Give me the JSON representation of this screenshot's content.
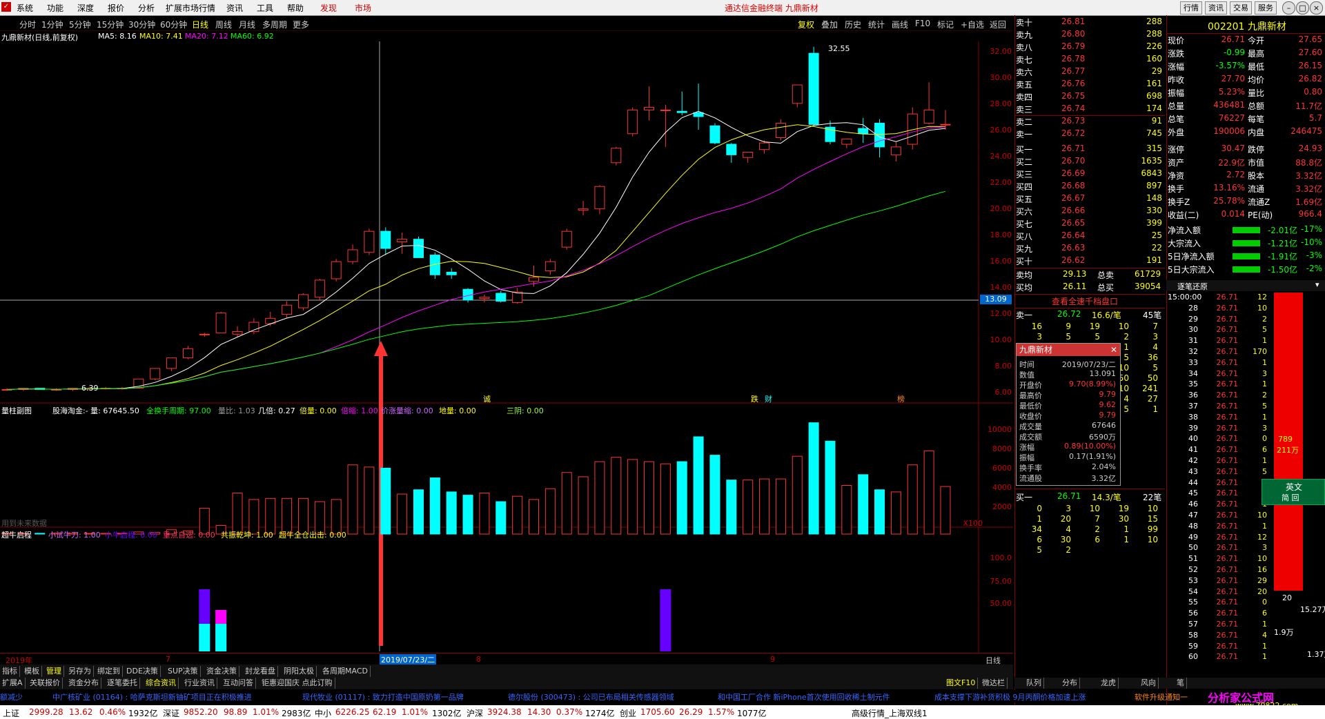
{
  "menu": {
    "items": [
      "系统",
      "功能",
      "深度",
      "报价",
      "分析",
      "扩展市场行情",
      "资讯",
      "工具",
      "帮助"
    ],
    "discover": "发现",
    "market": "市场",
    "title": "通达信金融终端  九鼎新材",
    "right_buttons": [
      "行情",
      "资讯",
      "交易",
      "服务"
    ]
  },
  "period_tabs": [
    "分时",
    "1分钟",
    "5分钟",
    "15分钟",
    "30分钟",
    "60分钟",
    "日线",
    "周线",
    "月线",
    "多周期",
    "更多"
  ],
  "period_active": "日线",
  "right_tools": [
    "复权",
    "叠加",
    "历史",
    "统计",
    "画线",
    "F10",
    "标记",
    "+自选",
    "返回"
  ],
  "main_info": {
    "name": "九鼎新材(日线,前复权)",
    "ma5": "MA5: 8.16",
    "ma10": "MA10: 7.41",
    "ma20": "MA20: 7.12",
    "ma60": "MA60: 6.92"
  },
  "price_axis": [
    "32.00",
    "30.00",
    "28.00",
    "26.00",
    "24.00",
    "22.00",
    "20.00",
    "18.00",
    "16.00",
    "14.00",
    "12.00",
    "10.00",
    "8.00",
    "6.00"
  ],
  "crosshair_price": "13.09",
  "high_label": "32.55",
  "low_label": "6.39",
  "markers": [
    "诚",
    "跌",
    "财",
    "榜"
  ],
  "volume_info": {
    "title": "量柱副图",
    "text1": "股海淘金:- 量: 67645.50",
    "text2": "全换手周期: 97.00",
    "text3": "量比: 1.03",
    "text4": "几倍: 0.27",
    "text5": "倍量: 0.00",
    "text6": "倍缩: 1.00",
    "text7": "价涨量缩: 0.00",
    "text8": "地量: 0.00",
    "text9": "三阴: 0.00",
    "watermark": "用到未来数据"
  },
  "volume_axis": [
    "10000",
    "8000",
    "6000",
    "4000",
    "2000"
  ],
  "volume_unit": "X100",
  "ind_info": {
    "title": "超牛启程",
    "t1": "小试牛刀: 1.00",
    "t2": "小牛启程: 0.00",
    "t3": "重点自选: 0.00",
    "t4": "共振乾坤: 1.00",
    "t5": "超牛全仓出击: 0.00"
  },
  "ind_axis": [
    "100.0",
    "75.00",
    "50.00"
  ],
  "time_axis": {
    "year": "2019年",
    "m7": "7",
    "date": "2019/07/23/二",
    "m8": "8",
    "m9": "9",
    "period": "日线"
  },
  "chart_data": {
    "type": "candlestick",
    "ylim": [
      6,
      33
    ],
    "candles": [
      [
        6.6,
        6.7,
        6.5,
        6.6
      ],
      [
        6.6,
        6.7,
        6.5,
        6.7
      ],
      [
        6.7,
        6.7,
        6.6,
        6.6
      ],
      [
        6.6,
        6.7,
        6.5,
        6.6
      ],
      [
        6.6,
        6.7,
        6.5,
        6.7
      ],
      [
        6.7,
        6.8,
        6.6,
        6.7
      ],
      [
        6.7,
        6.8,
        6.6,
        6.7
      ],
      [
        6.7,
        6.8,
        6.6,
        6.7
      ],
      [
        6.7,
        7.4,
        6.7,
        7.4
      ],
      [
        7.4,
        8.2,
        7.3,
        8.2
      ],
      [
        8.2,
        9.0,
        8.0,
        9.0
      ],
      [
        9.0,
        9.9,
        8.9,
        9.7
      ],
      [
        10.8,
        10.9,
        10.6,
        10.8
      ],
      [
        10.9,
        12.5,
        10.9,
        12.4
      ],
      [
        10.8,
        11.4,
        10.6,
        11.0
      ],
      [
        11.0,
        12.0,
        10.8,
        11.7
      ],
      [
        11.6,
        12.5,
        11.4,
        12.0
      ],
      [
        12.3,
        13.3,
        12.0,
        13.0
      ],
      [
        12.8,
        13.9,
        12.6,
        13.8
      ],
      [
        13.6,
        15.0,
        13.4,
        14.9
      ],
      [
        15.0,
        16.5,
        14.8,
        16.3
      ],
      [
        16.3,
        17.6,
        16.1,
        17.2
      ],
      [
        17.0,
        18.8,
        16.8,
        18.6
      ],
      [
        18.6,
        18.9,
        16.8,
        17.3
      ],
      [
        17.8,
        18.5,
        16.9,
        18.0
      ],
      [
        18.0,
        18.2,
        16.6,
        16.6
      ],
      [
        16.8,
        17.0,
        15.0,
        15.3
      ],
      [
        15.5,
        15.8,
        15.0,
        15.3
      ],
      [
        14.2,
        14.3,
        13.2,
        13.4
      ],
      [
        13.5,
        13.8,
        13.2,
        13.6
      ],
      [
        13.9,
        14.1,
        13.2,
        13.3
      ],
      [
        13.2,
        14.3,
        13.1,
        14.0
      ],
      [
        14.8,
        16.0,
        14.4,
        15.1
      ],
      [
        15.6,
        16.5,
        15.3,
        16.3
      ],
      [
        17.4,
        18.8,
        17.2,
        18.6
      ],
      [
        20.2,
        20.9,
        19.8,
        20.3
      ],
      [
        20.3,
        22.1,
        19.9,
        22.0
      ],
      [
        23.8,
        25.0,
        23.6,
        24.9
      ],
      [
        26.0,
        28.0,
        25.8,
        27.8
      ],
      [
        27.8,
        29.6,
        27.0,
        28.0
      ],
      [
        27.8,
        28.2,
        25.0,
        27.8
      ],
      [
        27.7,
        29.2,
        27.4,
        27.6
      ],
      [
        27.6,
        29.8,
        26.3,
        27.3
      ],
      [
        26.6,
        26.8,
        25.2,
        25.3
      ],
      [
        25.2,
        25.3,
        23.8,
        24.4
      ],
      [
        24.2,
        24.5,
        23.8,
        24.6
      ],
      [
        24.8,
        25.5,
        24.5,
        25.3
      ],
      [
        25.7,
        27.1,
        25.5,
        26.8
      ],
      [
        28.3,
        29.7,
        28.0,
        29.7
      ],
      [
        32.1,
        32.6,
        26.6,
        26.7
      ],
      [
        26.5,
        27.0,
        25.2,
        25.4
      ],
      [
        25.2,
        25.6,
        24.9,
        25.6
      ],
      [
        26.4,
        27.2,
        25.3,
        26.0
      ],
      [
        26.8,
        27.1,
        24.2,
        25.0
      ],
      [
        24.4,
        25.4,
        23.9,
        25.0
      ],
      [
        25.2,
        28.0,
        24.8,
        27.5
      ],
      [
        26.8,
        29.9,
        26.7,
        27.8
      ],
      [
        26.7,
        27.8,
        26.3,
        26.71
      ]
    ],
    "volume": [
      80,
      60,
      70,
      90,
      50,
      60,
      70,
      60,
      200,
      150,
      400,
      300,
      2400,
      800,
      3800,
      3200,
      3300,
      3300,
      3300,
      3000,
      3200,
      6400,
      6200,
      6100,
      3700,
      4100,
      5200,
      3900,
      3600,
      3800,
      3000,
      3500,
      3200,
      4200,
      5700,
      5300,
      6700,
      7100,
      6900,
      6700,
      6500,
      6700,
      9000,
      7300,
      5000,
      5000,
      5100,
      5100,
      7200,
      10300,
      8600,
      4500,
      5500,
      4100,
      3900,
      6400,
      7700,
      4400
    ],
    "ind_bars": [
      {
        "i": 20,
        "h1": 40,
        "c": "#0ff"
      },
      {
        "i": 21,
        "h1": 40,
        "c": "#0ff"
      },
      {
        "i": 20,
        "h2": 60,
        "c": "#f0f"
      },
      {
        "i": 21,
        "h2": 60,
        "c": "#f0f"
      }
    ]
  },
  "order_book": {
    "asks": [
      [
        "卖十",
        "26.81",
        "288"
      ],
      [
        "卖九",
        "26.80",
        "288"
      ],
      [
        "卖八",
        "26.79",
        "226"
      ],
      [
        "卖七",
        "26.78",
        "160"
      ],
      [
        "卖六",
        "26.77",
        "29"
      ],
      [
        "卖五",
        "26.76",
        "161"
      ],
      [
        "卖四",
        "26.75",
        "698"
      ],
      [
        "卖三",
        "26.74",
        "174"
      ],
      [
        "卖二",
        "26.73",
        "91"
      ],
      [
        "卖一",
        "26.72",
        "745"
      ]
    ],
    "bids": [
      [
        "买一",
        "26.71",
        "315"
      ],
      [
        "买二",
        "26.70",
        "1635"
      ],
      [
        "买三",
        "26.69",
        "6843"
      ],
      [
        "买四",
        "26.68",
        "897"
      ],
      [
        "买五",
        "26.67",
        "148"
      ],
      [
        "买六",
        "26.66",
        "330"
      ],
      [
        "买七",
        "26.65",
        "399"
      ],
      [
        "买八",
        "26.64",
        "25"
      ],
      [
        "买九",
        "26.63",
        "22"
      ],
      [
        "买十",
        "26.62",
        "191"
      ]
    ],
    "avg_sell_label": "卖均",
    "avg_sell": "29.13",
    "total_sell_label": "总卖",
    "total_sell": "61729",
    "avg_buy_label": "买均",
    "avg_buy": "26.11",
    "total_buy_label": "总买",
    "total_buy": "39054",
    "full_queue": "查看全速千档盘口",
    "sell1_label": "卖一",
    "sell1_price": "26.72",
    "sell1_avg": "16.6/笔",
    "sell1_count": "45笔",
    "sell_queue": [
      [
        "16",
        "9",
        "19",
        "10",
        "7"
      ],
      [
        "3",
        "5",
        "5",
        "2",
        "3"
      ],
      [
        "",
        "",
        "",
        "1",
        "4"
      ],
      [
        "",
        "",
        "",
        "5",
        "36"
      ],
      [
        "",
        "",
        "",
        "10",
        "5"
      ],
      [
        "",
        "",
        "",
        "50",
        "50"
      ],
      [
        "",
        "",
        "",
        "10",
        "241"
      ],
      [
        "",
        "",
        "",
        "4",
        "27"
      ],
      [
        "",
        "",
        "",
        "5",
        "1"
      ]
    ],
    "buy1_label": "买一",
    "buy1_price": "26.71",
    "buy1_avg": "14.3/笔",
    "buy1_count": "22笔",
    "buy_queue": [
      [
        "0",
        "3",
        "10",
        "19",
        "10"
      ],
      [
        "1",
        "20",
        "7",
        "30",
        "15"
      ],
      [
        "34",
        "4",
        "2",
        "1",
        "99"
      ],
      [
        "6",
        "30",
        "6",
        "1",
        "10"
      ],
      [
        "5",
        "2",
        "",
        "",
        ""
      ]
    ]
  },
  "popup": {
    "title": "九鼎新材",
    "rows": [
      [
        "时间",
        "2019/07/23/二"
      ],
      [
        "数值",
        "13.091"
      ],
      [
        "开盘价",
        "9.70(8.99%)"
      ],
      [
        "最高价",
        "9.79"
      ],
      [
        "最低价",
        "9.62"
      ],
      [
        "收盘价",
        "9.79"
      ],
      [
        "成交量",
        "67646"
      ],
      [
        "成交额",
        "6590万"
      ],
      [
        "涨幅",
        "0.89(10.00%)"
      ],
      [
        "振幅",
        "0.17(1.91%)"
      ],
      [
        "换手率",
        "2.04%"
      ],
      [
        "流通股",
        "3.32亿"
      ]
    ]
  },
  "stock_header": {
    "code_name": "002201 九鼎新材"
  },
  "stats": [
    [
      "现价",
      "26.71",
      "今开",
      "27.65"
    ],
    [
      "涨跌",
      "-0.99",
      "最高",
      "27.60"
    ],
    [
      "涨幅",
      "-3.57%",
      "最低",
      "26.15"
    ],
    [
      "昨收",
      "27.70",
      "均价",
      "26.82"
    ],
    [
      "振幅",
      "5.23%",
      "量比",
      "0.80"
    ],
    [
      "总量",
      "436481",
      "总额",
      "11.7亿"
    ],
    [
      "总笔",
      "76227",
      "每笔",
      "5.7"
    ],
    [
      "外盘",
      "190006",
      "内盘",
      "246475"
    ],
    [
      "涨停",
      "30.47",
      "跌停",
      "24.93"
    ],
    [
      "资产",
      "22.9亿",
      "市值",
      "88.8亿"
    ],
    [
      "净资",
      "2.72",
      "股本",
      "3.32亿"
    ],
    [
      "换手",
      "13.16%",
      "流通",
      "3.32亿"
    ],
    [
      "换手Z",
      "25.78%",
      "流通Z",
      "1.69亿"
    ],
    [
      "收益(二)",
      "0.014",
      "PE(动)",
      "966.4"
    ]
  ],
  "flows": [
    [
      "净流入额",
      "-2.01亿",
      "-17%"
    ],
    [
      "大宗流入",
      "-1.21亿",
      "-10%"
    ],
    [
      "5日净流入额",
      "-1.91亿",
      "-3%"
    ],
    [
      "5日大宗流入",
      "-1.50亿",
      "-2%"
    ]
  ],
  "tick_panel": {
    "title": "逐笔还原",
    "rows": [
      [
        "15:00:00",
        "26.71",
        "12"
      ],
      [
        "28",
        "26.71",
        "10"
      ],
      [
        "29",
        "26.71",
        "2"
      ],
      [
        "30",
        "26.71",
        "5"
      ],
      [
        "31",
        "26.71",
        "1"
      ],
      [
        "32",
        "26.71",
        "170"
      ],
      [
        "33",
        "26.71",
        "1"
      ],
      [
        "34",
        "26.71",
        "3"
      ],
      [
        "35",
        "26.71",
        "1"
      ],
      [
        "36",
        "26.71",
        "2"
      ],
      [
        "37",
        "26.71",
        "5"
      ],
      [
        "38",
        "26.71",
        "1"
      ],
      [
        "39",
        "26.71",
        "3"
      ],
      [
        "40",
        "26.71",
        "0"
      ],
      [
        "41",
        "26.71",
        "6"
      ],
      [
        "42",
        "26.71",
        "1"
      ],
      [
        "43",
        "26.71",
        "5"
      ],
      [
        "44",
        "26.71",
        "1"
      ],
      [
        "45",
        "26.71",
        "3"
      ],
      [
        "46",
        "26.71",
        "1"
      ],
      [
        "47",
        "26.71",
        "10"
      ],
      [
        "48",
        "26.71",
        "1"
      ],
      [
        "49",
        "26.71",
        "12"
      ],
      [
        "50",
        "26.71",
        "3"
      ],
      [
        "51",
        "26.71",
        "10"
      ],
      [
        "52",
        "26.71",
        "16"
      ],
      [
        "53",
        "26.71",
        "29"
      ],
      [
        "54",
        "26.71",
        "20"
      ],
      [
        "55",
        "26.71",
        "0"
      ],
      [
        "56",
        "26.71",
        "6"
      ],
      [
        "57",
        "26.71",
        "1"
      ],
      [
        "58",
        "26.71",
        "4"
      ],
      [
        "59",
        "26.71",
        "1"
      ],
      [
        "60",
        "26.71",
        "1"
      ]
    ],
    "bar_big_text": "789",
    "bar_big_sub": "211万",
    "side_values": [
      "20",
      "15.27万",
      "1.9万",
      "1.37万"
    ]
  },
  "ime": {
    "label": "英文",
    "sub": "简 回"
  },
  "bottom_tabs1": [
    "指标",
    "模板",
    "管理",
    "另存为",
    "绑定到",
    "DDE决策",
    "SUP决策",
    "资金决策",
    "封龙看盘",
    "阴阳太极",
    "各周期MACD"
  ],
  "bottom_tabs2": [
    "扩展A",
    "关联报价",
    "资金分布",
    "逐笔委托",
    "综合资讯",
    "行业资讯",
    "互动问答",
    "钜惠迎国庆 点此订购"
  ],
  "right_panel_tabs": [
    "队列",
    "分布",
    "龙虎",
    "风向",
    "笔"
  ],
  "side_links": [
    "图文F10",
    "微达栏"
  ],
  "news": [
    "额减少",
    "中广核矿业 (01164) : 哈萨克斯坦新铀矿项目正在积极推进",
    "现代牧业 (01117) : 致力打造中国原奶第一品牌",
    "德尔股份 (300473) : 公司已布局相关传感器领域",
    "和中国工厂合作 新iPhone首次使用回收稀土制元件",
    "成本支撑下游补货积极 9月丙酮价格加速上涨"
  ],
  "software_note": "软件升级通知一",
  "status": {
    "sh": [
      "上证",
      "2999.28",
      "13.62",
      "0.46%",
      "1932亿"
    ],
    "sz": [
      "深证",
      "9852.20",
      "98.89",
      "1.01%",
      "2983亿"
    ],
    "zx": [
      "中小",
      "6226.25",
      "62.19",
      "1.01%",
      "1302亿"
    ],
    "hs": [
      "沪深",
      "3924.38",
      "14.30",
      "0.37%",
      "1274亿"
    ],
    "cy": [
      "创业",
      "1705.60",
      "26.29",
      "1.57%",
      "1077亿"
    ],
    "conn": "高级行情_上海双线1"
  },
  "watermark_brand": "分析家公式网",
  "watermark_url": "www.70822.com"
}
